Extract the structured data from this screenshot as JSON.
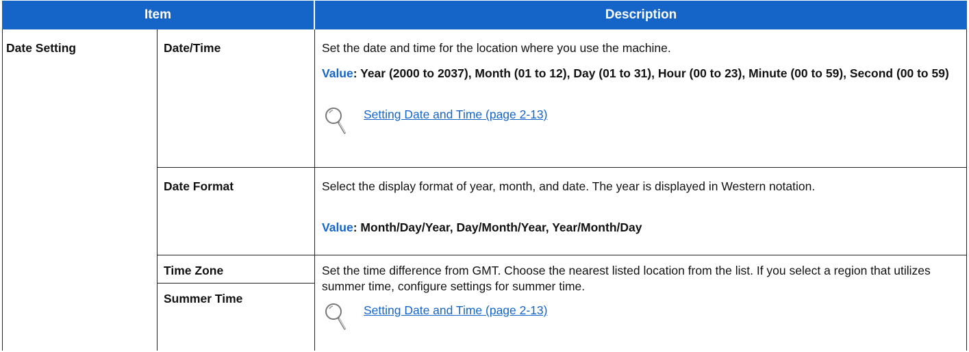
{
  "header": {
    "item": "Item",
    "description": "Description"
  },
  "group_label": "Date Setting",
  "rows": [
    {
      "name": "Date/Time",
      "description": "Set the date and time for the location where you use the machine.",
      "value_key": "Value",
      "value_text": ": Year (2000 to 2037), Month (01 to 12), Day (01 to 31), Hour (00 to 23), Minute (00 to 59), Second (00 to 59)",
      "link": "Setting Date and Time (page 2-13)"
    },
    {
      "name": "Date Format",
      "description": "Select the display format of year, month, and date. The year is displayed in Western notation.",
      "value_key": "Value",
      "value_text": ": Month/Day/Year, Day/Month/Year, Year/Month/Day"
    },
    {
      "name": "Time Zone",
      "description": "Set the time difference from GMT. Choose the nearest listed location from the list. If you select a region that utilizes summer time, configure settings for summer time.",
      "link": "Setting Date and Time (page 2-13)"
    },
    {
      "name": "Summer Time"
    }
  ],
  "icons": {
    "reference": "magnifier-icon"
  },
  "colors": {
    "header_bg": "#1565c8",
    "link": "#1565c8",
    "header_text": "#ffffff"
  }
}
